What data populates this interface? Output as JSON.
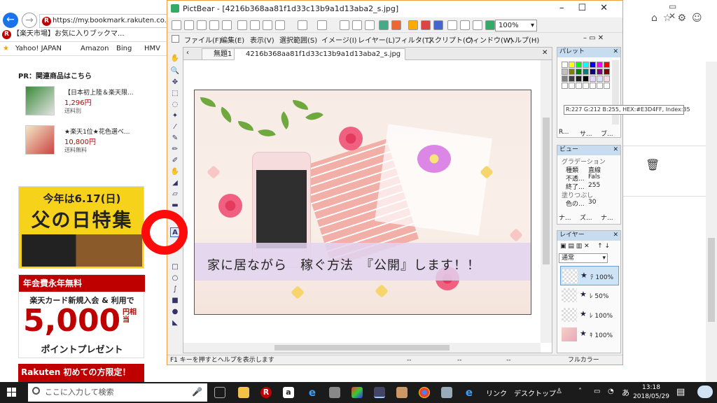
{
  "browser": {
    "url": "https://my.bookmark.rakuten.co.jp/?l-id=st",
    "tab_title": "【楽天市場】お気に入りブックマ...",
    "favorites": [
      "Yahoo! JAPAN",
      "Amazon",
      "Bing",
      "HMV"
    ]
  },
  "page": {
    "pr_title": "PR：関連商品はこちら",
    "products": [
      {
        "name": "【日本初上陸＆楽天限...",
        "price": "1,296円",
        "shipping": "送料別"
      },
      {
        "name": "★楽天1位★花色選べ...",
        "price": "10,800円",
        "shipping": "送料無料"
      }
    ],
    "banner1": {
      "line1": "今年は6.17(日)",
      "line2": "父の日特集"
    },
    "banner2": {
      "header": "年会費永年無料",
      "line": "楽天カード新規入会 & 利用で",
      "amount": "5,000",
      "unit": "円相当",
      "footer": "ポイントプレゼント"
    },
    "banner3": {
      "text": "Rakuten 初めての方限定！"
    }
  },
  "pictbear": {
    "title": "PictBear - [4216b368aa81f1d33c13b9a1d13aba2_s.jpg]",
    "zoom": "100%",
    "menu": [
      "ファイル(F)",
      "編集(E)",
      "表示(V)",
      "選択範囲(S)",
      "イメージ(I)",
      "レイヤー(L)",
      "フィルタ(T)",
      "スクリプト(C)",
      "ウィンドウ(W)",
      "ヘルプ(H)"
    ],
    "tabs": [
      "無題1",
      "4216b368aa81f1d33c13b9a1d13aba2_s.jpg"
    ],
    "caption": "家に居ながら　稼ぐ方法　『公開』します！！",
    "status": {
      "hint": "F1 キーを押すとヘルプを表示します",
      "pos": "--",
      "size": "--",
      "sel": "--",
      "mode": "フルカラー"
    },
    "palette": {
      "title": "パレット",
      "tooltip": "R:227 G:212 B:255, HEX:#E3D4FF, Index:35",
      "tabs": [
        "R...",
        "サ...",
        "ブ..."
      ],
      "colors": [
        "#ffffff",
        "#ffff00",
        "#00ff00",
        "#00ffff",
        "#0000ff",
        "#ff00ff",
        "#ff0000",
        "#c0c0c0",
        "#808000",
        "#008000",
        "#008080",
        "#000080",
        "#800080",
        "#800000",
        "#808080",
        "#404040",
        "#202020",
        "#000000",
        "#e3d4ff",
        "#d4e4ff",
        "#ffd4e4",
        "#ffffff",
        "#ffffff",
        "#ffffff",
        "#ffffff",
        "#ffffff",
        "#ffffff",
        "#ffffff"
      ]
    },
    "view": {
      "title": "ビュー",
      "section1": "グラデーション",
      "rows": [
        [
          "種類",
          "直線"
        ],
        [
          "不透...",
          "Fals"
        ],
        [
          "終了...",
          "255"
        ]
      ],
      "section2": "塗りつぶし",
      "row2": [
        "色の...",
        "30"
      ],
      "tabs": [
        "ナ...",
        "ズ...",
        "ナ..."
      ]
    },
    "layers": {
      "title": "レイヤー",
      "blend": "通常",
      "items": [
        {
          "label": "ﾃ 100%"
        },
        {
          "label": "ﾚ 50%"
        },
        {
          "label": "ﾚ 100%"
        },
        {
          "label": "ｷ 100%"
        }
      ]
    }
  },
  "taskbar": {
    "search_placeholder": "ここに入力して検索",
    "links": "リンク　デスクトップ",
    "time": "13:18",
    "date": "2018/05/29",
    "ime": "あ"
  }
}
